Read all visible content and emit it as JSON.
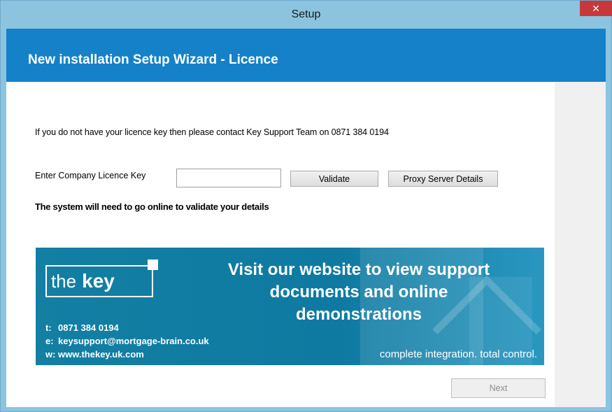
{
  "window": {
    "title": "Setup",
    "close_glyph": "✕"
  },
  "header": {
    "title": "New installation Setup Wizard - Licence"
  },
  "content": {
    "info_text": "If you do not have your licence key then please contact Key Support Team on 0871 384 0194",
    "licence_label": "Enter Company Licence Key",
    "licence_value": "",
    "validate_label": "Validate",
    "proxy_label": "Proxy Server Details",
    "online_note": "The system will need to go online to validate your details"
  },
  "banner": {
    "logo_the": "the",
    "logo_key": "key",
    "headline_1": "Visit our website to view support",
    "headline_2": "documents and online",
    "headline_3": "demonstrations",
    "phone_prefix": "t:",
    "phone": "0871 384 0194",
    "email_prefix": "e:",
    "email": "keysupport@mortgage-brain.co.uk",
    "web_prefix": "w:",
    "web": "www.thekey.uk.com",
    "tagline": "complete integration. total control.",
    "colors": {
      "background": "#127fa3",
      "text": "#ffffff"
    }
  },
  "footer": {
    "next_label": "Next",
    "next_enabled": false
  },
  "colors": {
    "titlebar": "#8cc4e0",
    "header_band": "#1581c8",
    "close_button": "#c7383a"
  }
}
